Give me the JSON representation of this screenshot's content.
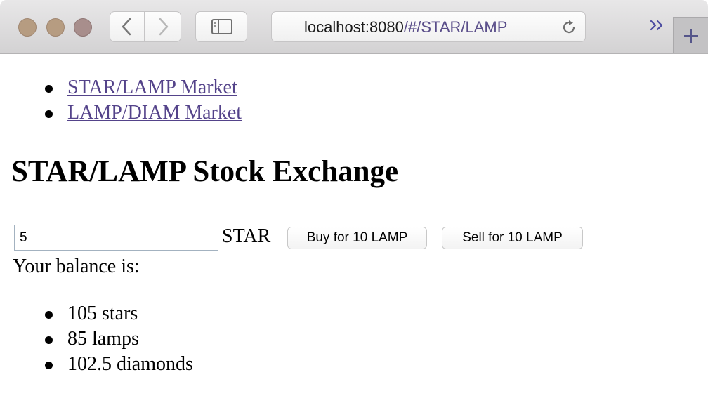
{
  "browser": {
    "address_host": "localhost:8080",
    "address_path": "/#/STAR/LAMP"
  },
  "nav": {
    "links": [
      "STAR/LAMP Market",
      "LAMP/DIAM Market"
    ]
  },
  "main": {
    "title": "STAR/LAMP Stock Exchange",
    "quantity_value": "5",
    "unit_label": "STAR",
    "buy_label": "Buy for 10 LAMP",
    "sell_label": "Sell for 10 LAMP",
    "balance_label": "Your balance is:",
    "balances": [
      "105 stars",
      "85 lamps",
      "102.5 diamonds"
    ]
  },
  "colors": {
    "link": "#54438a",
    "toolbar": "#d9d8d9",
    "traffic_light": "#b19a83"
  }
}
